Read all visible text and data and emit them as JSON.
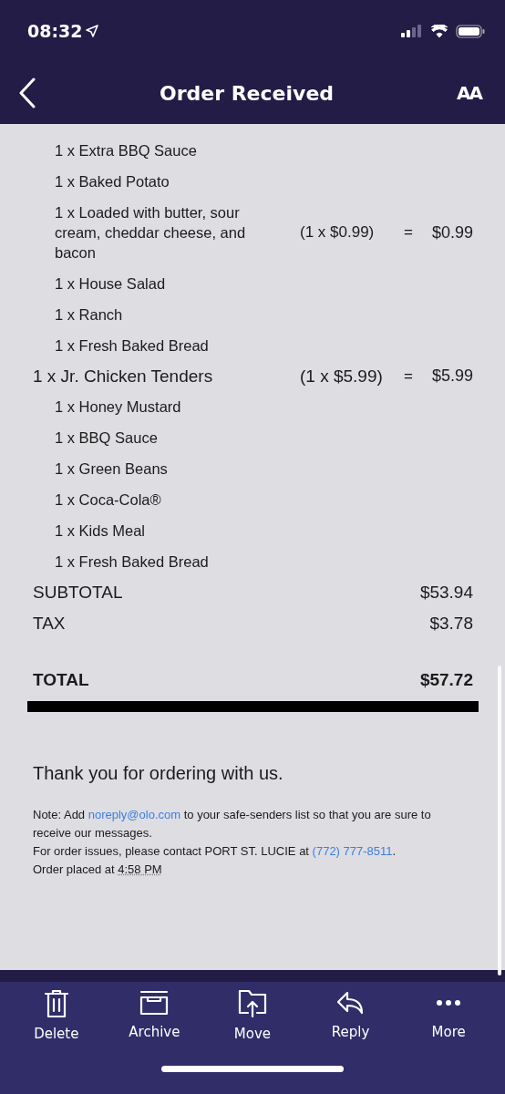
{
  "status_bar": {
    "time": "08:32"
  },
  "nav": {
    "title": "Order Received",
    "text_size": "AA"
  },
  "items": [
    {
      "kind": "sub",
      "label": "1 x Extra BBQ Sauce"
    },
    {
      "kind": "sub",
      "label": "1 x Baked Potato"
    },
    {
      "kind": "sub",
      "label": "1 x Loaded with butter, sour cream, cheddar cheese, and bacon",
      "unit": "(1 x $0.99)",
      "equals": "=",
      "price": "$0.99"
    },
    {
      "kind": "sub",
      "label": "1 x House Salad"
    },
    {
      "kind": "sub",
      "label": "1 x Ranch"
    },
    {
      "kind": "sub",
      "label": "1 x Fresh Baked Bread"
    },
    {
      "kind": "main",
      "label": "1 x Jr. Chicken Tenders",
      "unit": "(1 x $5.99)",
      "equals": "=",
      "price": "$5.99"
    },
    {
      "kind": "sub",
      "label": "1 x Honey Mustard"
    },
    {
      "kind": "sub",
      "label": "1 x BBQ Sauce"
    },
    {
      "kind": "sub",
      "label": "1 x Green Beans"
    },
    {
      "kind": "sub",
      "label": "1 x Coca-Cola®"
    },
    {
      "kind": "sub",
      "label": "1 x Kids Meal"
    },
    {
      "kind": "sub",
      "label": "1 x Fresh Baked Bread"
    }
  ],
  "summary": [
    {
      "label": "SUBTOTAL",
      "value": "$53.94"
    },
    {
      "label": "TAX",
      "value": "$3.78"
    }
  ],
  "total": {
    "label": "TOTAL",
    "value": "$57.72"
  },
  "thanks": "Thank you for ordering with us.",
  "note_lines": [
    [
      {
        "kind": "plain",
        "text": "Note: Add "
      },
      {
        "kind": "link",
        "text": "noreply@olo.com"
      },
      {
        "kind": "plain",
        "text": " to your safe-senders list so that you are sure to receive our messages."
      }
    ],
    [
      {
        "kind": "plain",
        "text": "For order issues, please contact PORT ST. LUCIE at "
      },
      {
        "kind": "link",
        "text": "(772) 777-8511"
      },
      {
        "kind": "plain",
        "text": "."
      }
    ],
    [
      {
        "kind": "plain",
        "text": "Order placed at "
      },
      {
        "kind": "time",
        "text": "4:58 PM"
      }
    ]
  ],
  "toolbar": [
    {
      "kind": "delete",
      "label": "Delete"
    },
    {
      "kind": "archive",
      "label": "Archive"
    },
    {
      "kind": "move",
      "label": "Move"
    },
    {
      "kind": "reply",
      "label": "Reply"
    },
    {
      "kind": "more",
      "label": "More"
    }
  ]
}
